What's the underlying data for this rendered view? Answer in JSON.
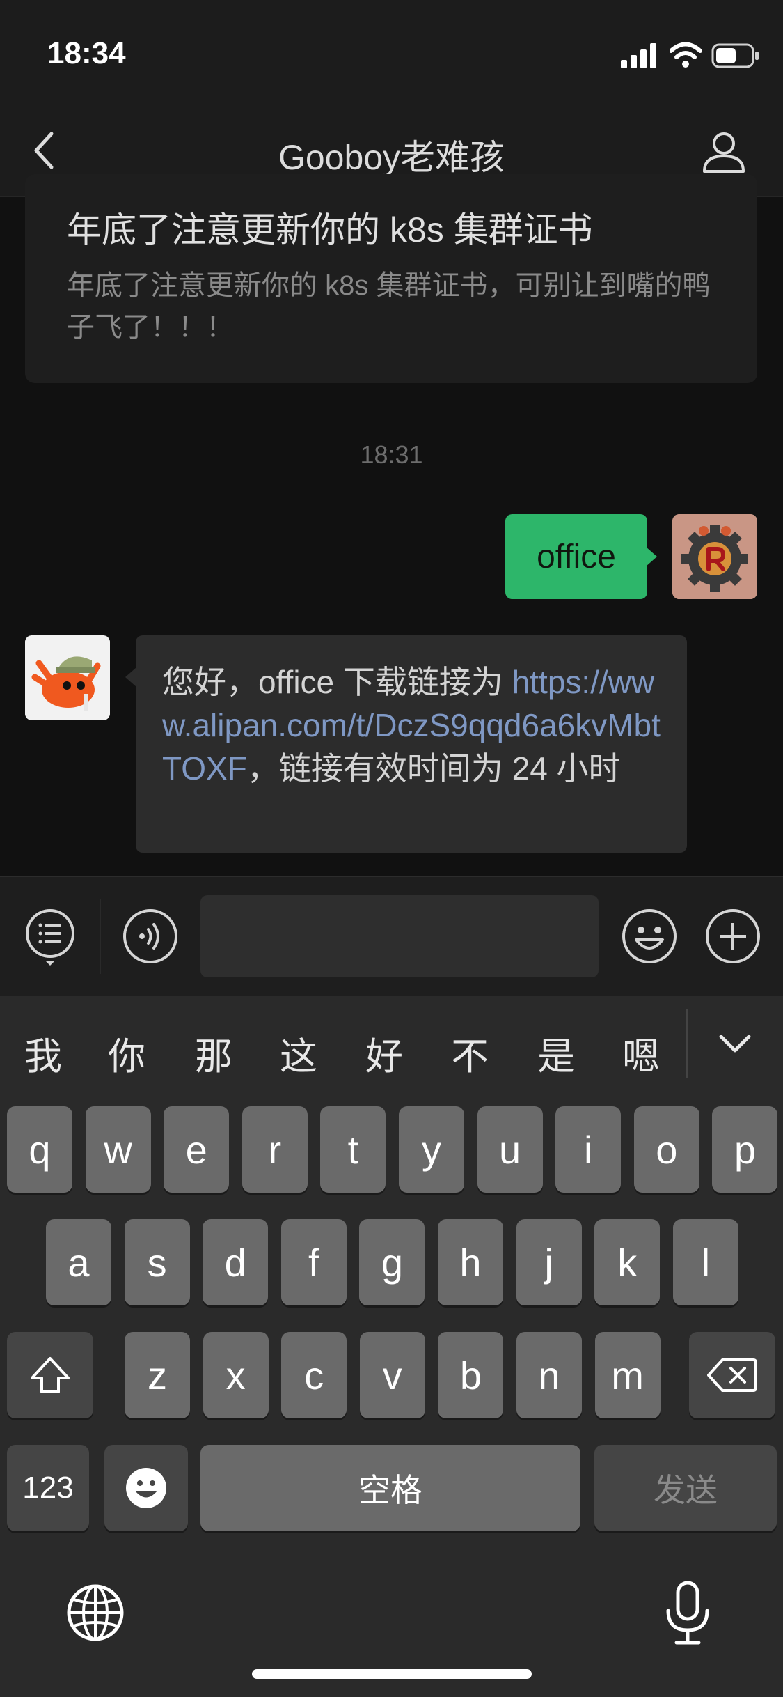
{
  "status_bar": {
    "time": "18:34"
  },
  "header": {
    "title": "Gooboy老难孩",
    "back_icon": "chevron-left-icon",
    "profile_icon": "person-icon"
  },
  "article": {
    "title": "年底了注意更新你的 k8s 集群证书",
    "description": "年底了注意更新你的 k8s 集群证书，可别让到嘴的鸭子飞了！！！"
  },
  "timestamp": "18:31",
  "messages": {
    "sent": {
      "text": "office"
    },
    "received": {
      "prefix": "您好，office 下载链接为 ",
      "link": "https://www.alipan.com/t/DczS9qqd6a6kvMbtTOXF",
      "suffix": "，链接有效时间为 24 小时"
    }
  },
  "input": {
    "value": ""
  },
  "keyboard": {
    "candidates": [
      "我",
      "你",
      "那",
      "这",
      "好",
      "不",
      "是",
      "嗯"
    ],
    "row1": [
      "q",
      "w",
      "e",
      "r",
      "t",
      "y",
      "u",
      "i",
      "o",
      "p"
    ],
    "row2": [
      "a",
      "s",
      "d",
      "f",
      "g",
      "h",
      "j",
      "k",
      "l"
    ],
    "row3": [
      "z",
      "x",
      "c",
      "v",
      "b",
      "n",
      "m"
    ],
    "numbers_label": "123",
    "space_label": "空格",
    "send_label": "发送"
  },
  "colors": {
    "sent_bubble": "#2db66a",
    "link": "#7f98c4",
    "background": "#111111"
  }
}
